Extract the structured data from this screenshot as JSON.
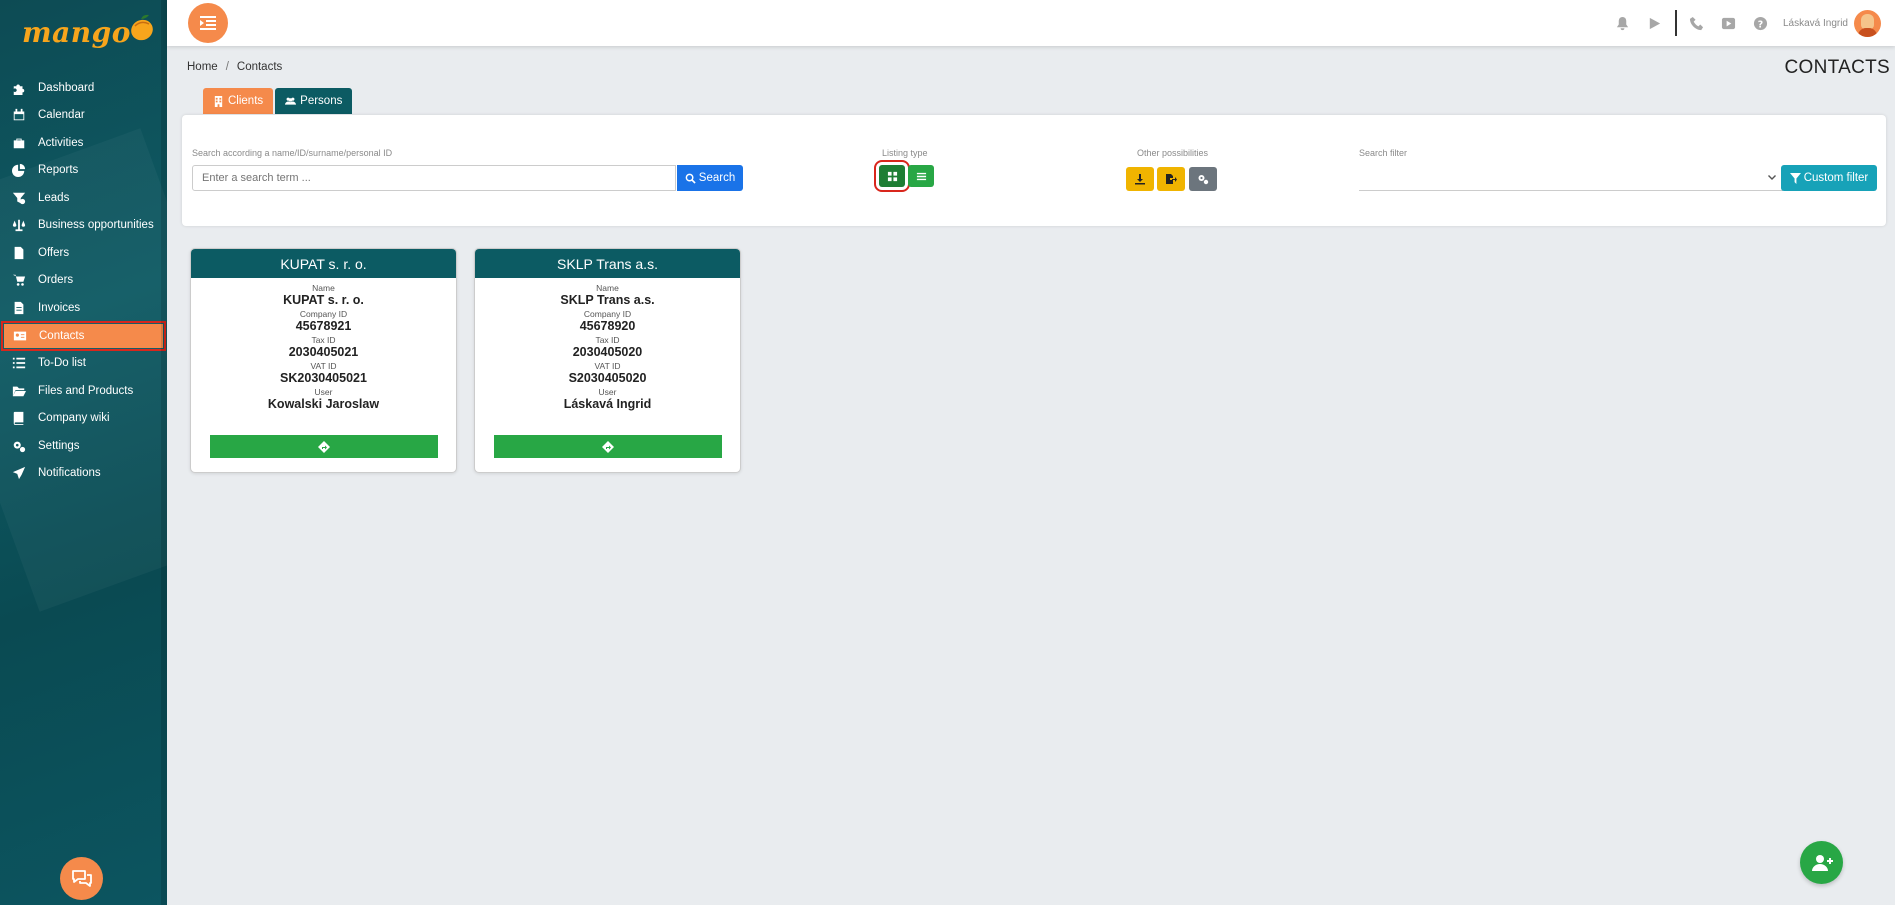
{
  "app": {
    "logo_text": "mango"
  },
  "sidebar": {
    "items": [
      {
        "label": "Dashboard",
        "icon": "puzzle-icon"
      },
      {
        "label": "Calendar",
        "icon": "calendar-icon"
      },
      {
        "label": "Activities",
        "icon": "briefcase-icon"
      },
      {
        "label": "Reports",
        "icon": "pie-chart-icon"
      },
      {
        "label": "Leads",
        "icon": "funnel-dollar-icon"
      },
      {
        "label": "Business opportunities",
        "icon": "balance-scale-icon"
      },
      {
        "label": "Offers",
        "icon": "file-icon"
      },
      {
        "label": "Orders",
        "icon": "cart-icon"
      },
      {
        "label": "Invoices",
        "icon": "invoice-icon"
      },
      {
        "label": "Contacts",
        "icon": "address-card-icon",
        "active": true
      },
      {
        "label": "To-Do list",
        "icon": "list-icon"
      },
      {
        "label": "Files and Products",
        "icon": "folder-open-icon"
      },
      {
        "label": "Company wiki",
        "icon": "book-icon"
      },
      {
        "label": "Settings",
        "icon": "cogs-icon"
      },
      {
        "label": "Notifications",
        "icon": "paper-plane-icon"
      }
    ]
  },
  "topbar": {
    "user_name": "Láskavá Ingrid"
  },
  "breadcrumb": {
    "home": "Home",
    "sep": "/",
    "current": "Contacts"
  },
  "page_title": "CONTACTS",
  "tabs": {
    "clients": "Clients",
    "persons": "Persons"
  },
  "search": {
    "label": "Search according a name/ID/surname/personal ID",
    "placeholder": "Enter a search term ...",
    "button": "Search"
  },
  "listing": {
    "label": "Listing type"
  },
  "other": {
    "label": "Other possibilities"
  },
  "filter": {
    "label": "Search filter",
    "custom_button": "Custom filter"
  },
  "cards": [
    {
      "title": "KUPAT s. r. o.",
      "fields": [
        {
          "label": "Name",
          "value": "KUPAT s. r. o."
        },
        {
          "label": "Company ID",
          "value": "45678921"
        },
        {
          "label": "Tax ID",
          "value": "2030405021"
        },
        {
          "label": "VAT ID",
          "value": "SK2030405021"
        },
        {
          "label": "User",
          "value": "Kowalski Jaroslaw"
        }
      ]
    },
    {
      "title": "SKLP Trans a.s.",
      "fields": [
        {
          "label": "Name",
          "value": "SKLP Trans a.s."
        },
        {
          "label": "Company ID",
          "value": "45678920"
        },
        {
          "label": "Tax ID",
          "value": "2030405020"
        },
        {
          "label": "VAT ID",
          "value": "S2030405020"
        },
        {
          "label": "User",
          "value": "Láskavá Ingrid"
        }
      ]
    }
  ],
  "colors": {
    "sidebar": "#0e5a63",
    "accent_orange": "#f58a4b",
    "primary_blue": "#1a73e8",
    "success_green": "#28a745",
    "info_teal": "#17a2b8",
    "warning_yellow": "#f0b400",
    "highlight_red": "#d9261c"
  }
}
